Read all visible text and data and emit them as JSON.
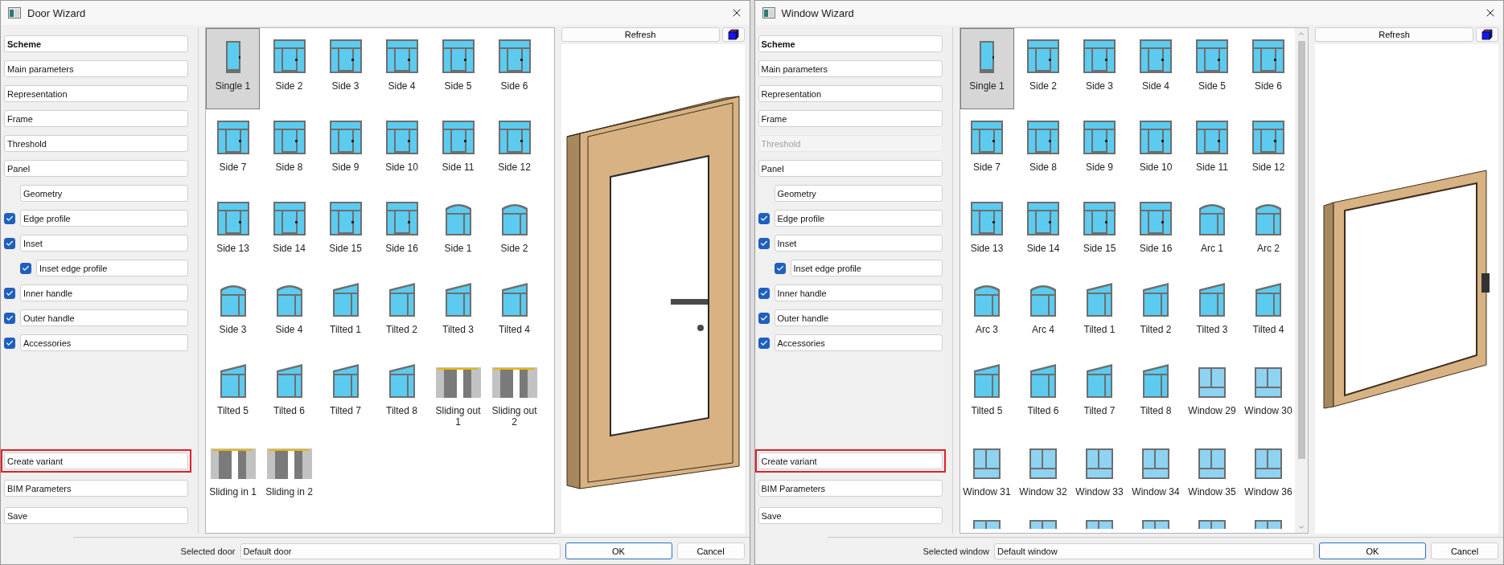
{
  "dialogs": [
    {
      "kind": "door",
      "title": "Door Wizard",
      "sidebar": {
        "items": [
          {
            "kind": "button",
            "label": "Scheme",
            "selected": true,
            "disabled": false
          },
          {
            "kind": "button",
            "label": "Main parameters",
            "selected": false,
            "disabled": false
          },
          {
            "kind": "button",
            "label": "Representation",
            "selected": false,
            "disabled": false
          },
          {
            "kind": "button",
            "label": "Frame",
            "selected": false,
            "disabled": false
          },
          {
            "kind": "button",
            "label": "Threshold",
            "selected": false,
            "disabled": false
          },
          {
            "kind": "button",
            "label": "Panel",
            "selected": false,
            "disabled": false,
            "children": [
              {
                "kind": "button",
                "label": "Geometry",
                "selected": false,
                "disabled": false
              }
            ]
          },
          {
            "kind": "checkbox",
            "label": "Edge profile",
            "checked": true,
            "selected": false,
            "disabled": false
          },
          {
            "kind": "checkbox",
            "label": "Inset",
            "checked": true,
            "selected": false,
            "disabled": false,
            "children": [
              {
                "kind": "checkbox",
                "label": "Inset edge profile",
                "checked": true,
                "selected": false,
                "disabled": false
              }
            ]
          },
          {
            "kind": "checkbox",
            "label": "Inner handle",
            "checked": true,
            "selected": false,
            "disabled": false
          },
          {
            "kind": "checkbox",
            "label": "Outer handle",
            "checked": true,
            "selected": false,
            "disabled": false
          },
          {
            "kind": "checkbox",
            "label": "Accessories",
            "checked": true,
            "selected": false,
            "disabled": false
          }
        ],
        "bottom_items": [
          {
            "label": "Create variant",
            "highlighted": true
          },
          {
            "label": "BIM Parameters",
            "highlighted": false
          },
          {
            "label": "Save",
            "highlighted": false
          }
        ]
      },
      "gallery": {
        "scrollable": false,
        "items": [
          {
            "kind": "single",
            "label": "Single 1",
            "selected": true
          },
          {
            "kind": "side",
            "label": "Side 2",
            "selected": false
          },
          {
            "kind": "side",
            "label": "Side 3",
            "selected": false
          },
          {
            "kind": "side",
            "label": "Side 4",
            "selected": false
          },
          {
            "kind": "side",
            "label": "Side 5",
            "selected": false
          },
          {
            "kind": "side",
            "label": "Side 6",
            "selected": false
          },
          {
            "kind": "side",
            "label": "Side 7",
            "selected": false
          },
          {
            "kind": "side",
            "label": "Side 8",
            "selected": false
          },
          {
            "kind": "side",
            "label": "Side 9",
            "selected": false
          },
          {
            "kind": "side",
            "label": "Side 10",
            "selected": false
          },
          {
            "kind": "side",
            "label": "Side 11",
            "selected": false
          },
          {
            "kind": "side",
            "label": "Side 12",
            "selected": false
          },
          {
            "kind": "side",
            "label": "Side 13",
            "selected": false
          },
          {
            "kind": "side",
            "label": "Side 14",
            "selected": false
          },
          {
            "kind": "side",
            "label": "Side 15",
            "selected": false
          },
          {
            "kind": "side",
            "label": "Side 16",
            "selected": false
          },
          {
            "kind": "arc",
            "label": "Side 1",
            "selected": false
          },
          {
            "kind": "arc",
            "label": "Side 2",
            "selected": false
          },
          {
            "kind": "arc",
            "label": "Side 3",
            "selected": false
          },
          {
            "kind": "arc",
            "label": "Side 4",
            "selected": false
          },
          {
            "kind": "tilted",
            "label": "Tilted 1",
            "selected": false
          },
          {
            "kind": "tilted",
            "label": "Tilted 2",
            "selected": false
          },
          {
            "kind": "tilted",
            "label": "Tilted 3",
            "selected": false
          },
          {
            "kind": "tilted",
            "label": "Tilted 4",
            "selected": false
          },
          {
            "kind": "tilted",
            "label": "Tilted 5",
            "selected": false
          },
          {
            "kind": "tilted",
            "label": "Tilted 6",
            "selected": false
          },
          {
            "kind": "tilted",
            "label": "Tilted 7",
            "selected": false
          },
          {
            "kind": "tilted",
            "label": "Tilted 8",
            "selected": false
          },
          {
            "kind": "sliding",
            "label": "Sliding out 1",
            "selected": false
          },
          {
            "kind": "sliding",
            "label": "Sliding out 2",
            "selected": false
          },
          {
            "kind": "sliding",
            "label": "Sliding in 1",
            "selected": false
          },
          {
            "kind": "sliding",
            "label": "Sliding in 2",
            "selected": false
          }
        ]
      },
      "preview": {
        "refresh_label": "Refresh"
      },
      "footer": {
        "label": "Selected door",
        "value": "Default door",
        "buttons": [
          {
            "label": "OK",
            "default": true
          },
          {
            "label": "Cancel",
            "default": false
          }
        ]
      }
    },
    {
      "kind": "window",
      "title": "Window Wizard",
      "sidebar": {
        "items": [
          {
            "kind": "button",
            "label": "Scheme",
            "selected": true,
            "disabled": false
          },
          {
            "kind": "button",
            "label": "Main parameters",
            "selected": false,
            "disabled": false
          },
          {
            "kind": "button",
            "label": "Representation",
            "selected": false,
            "disabled": false
          },
          {
            "kind": "button",
            "label": "Frame",
            "selected": false,
            "disabled": false
          },
          {
            "kind": "button",
            "label": "Threshold",
            "selected": false,
            "disabled": true
          },
          {
            "kind": "button",
            "label": "Panel",
            "selected": false,
            "disabled": false,
            "children": [
              {
                "kind": "button",
                "label": "Geometry",
                "selected": false,
                "disabled": false
              }
            ]
          },
          {
            "kind": "checkbox",
            "label": "Edge profile",
            "checked": true,
            "selected": false,
            "disabled": false
          },
          {
            "kind": "checkbox",
            "label": "Inset",
            "checked": true,
            "selected": false,
            "disabled": false,
            "children": [
              {
                "kind": "checkbox",
                "label": "Inset edge profile",
                "checked": true,
                "selected": false,
                "disabled": false
              }
            ]
          },
          {
            "kind": "checkbox",
            "label": "Inner handle",
            "checked": true,
            "selected": false,
            "disabled": false
          },
          {
            "kind": "checkbox",
            "label": "Outer handle",
            "checked": true,
            "selected": false,
            "disabled": false
          },
          {
            "kind": "checkbox",
            "label": "Accessories",
            "checked": true,
            "selected": false,
            "disabled": false
          }
        ],
        "bottom_items": [
          {
            "label": "Create variant",
            "highlighted": true
          },
          {
            "label": "BIM Parameters",
            "highlighted": false
          },
          {
            "label": "Save",
            "highlighted": false
          }
        ]
      },
      "gallery": {
        "scrollable": true,
        "items": [
          {
            "kind": "single",
            "label": "Single 1",
            "selected": true
          },
          {
            "kind": "side",
            "label": "Side 2",
            "selected": false
          },
          {
            "kind": "side",
            "label": "Side 3",
            "selected": false
          },
          {
            "kind": "side",
            "label": "Side 4",
            "selected": false
          },
          {
            "kind": "side",
            "label": "Side 5",
            "selected": false
          },
          {
            "kind": "side",
            "label": "Side 6",
            "selected": false
          },
          {
            "kind": "side",
            "label": "Side 7",
            "selected": false
          },
          {
            "kind": "side",
            "label": "Side 8",
            "selected": false
          },
          {
            "kind": "side",
            "label": "Side 9",
            "selected": false
          },
          {
            "kind": "side",
            "label": "Side 10",
            "selected": false
          },
          {
            "kind": "side",
            "label": "Side 11",
            "selected": false
          },
          {
            "kind": "side",
            "label": "Side 12",
            "selected": false
          },
          {
            "kind": "side",
            "label": "Side 13",
            "selected": false
          },
          {
            "kind": "side",
            "label": "Side 14",
            "selected": false
          },
          {
            "kind": "side",
            "label": "Side 15",
            "selected": false
          },
          {
            "kind": "side",
            "label": "Side 16",
            "selected": false
          },
          {
            "kind": "arc",
            "label": "Arc 1",
            "selected": false
          },
          {
            "kind": "arc",
            "label": "Arc 2",
            "selected": false
          },
          {
            "kind": "arc",
            "label": "Arc 3",
            "selected": false
          },
          {
            "kind": "arc",
            "label": "Arc 4",
            "selected": false
          },
          {
            "kind": "tilted",
            "label": "Tilted 1",
            "selected": false
          },
          {
            "kind": "tilted",
            "label": "Tilted 2",
            "selected": false
          },
          {
            "kind": "tilted",
            "label": "Tilted 3",
            "selected": false
          },
          {
            "kind": "tilted",
            "label": "Tilted 4",
            "selected": false
          },
          {
            "kind": "tilted",
            "label": "Tilted 5",
            "selected": false
          },
          {
            "kind": "tilted",
            "label": "Tilted 6",
            "selected": false
          },
          {
            "kind": "tilted",
            "label": "Tilted 7",
            "selected": false
          },
          {
            "kind": "tilted",
            "label": "Tilted 8",
            "selected": false
          },
          {
            "kind": "window",
            "label": "Window 29",
            "selected": false
          },
          {
            "kind": "window",
            "label": "Window 30",
            "selected": false
          },
          {
            "kind": "window",
            "label": "Window 31",
            "selected": false
          },
          {
            "kind": "window",
            "label": "Window 32",
            "selected": false
          },
          {
            "kind": "window",
            "label": "Window 33",
            "selected": false
          },
          {
            "kind": "window",
            "label": "Window 34",
            "selected": false
          },
          {
            "kind": "window",
            "label": "Window 35",
            "selected": false
          },
          {
            "kind": "window",
            "label": "Window 36",
            "selected": false
          },
          {
            "kind": "window",
            "selected": false
          },
          {
            "kind": "window",
            "selected": false
          },
          {
            "kind": "window",
            "selected": false
          },
          {
            "kind": "window",
            "selected": false
          },
          {
            "kind": "window",
            "selected": false
          },
          {
            "kind": "window",
            "selected": false
          }
        ]
      },
      "preview": {
        "refresh_label": "Refresh"
      },
      "footer": {
        "label": "Selected window",
        "value": "Default window",
        "buttons": [
          {
            "label": "OK",
            "default": true
          },
          {
            "label": "Cancel",
            "default": false
          }
        ]
      }
    }
  ]
}
